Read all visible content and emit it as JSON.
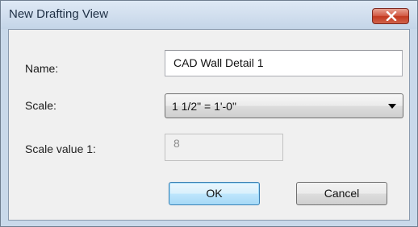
{
  "window": {
    "title": "New Drafting View"
  },
  "form": {
    "name_label": "Name:",
    "name_value": "CAD Wall Detail 1",
    "scale_label": "Scale:",
    "scale_selected": "1 1/2\" = 1'-0\"",
    "scale_value_label": "Scale value  1:",
    "scale_value": "8"
  },
  "buttons": {
    "ok": "OK",
    "cancel": "Cancel"
  },
  "icons": {
    "close": "close-icon",
    "dropdown": "chevron-down-icon"
  },
  "colors": {
    "titlebar": "#c4d5e8",
    "close_button": "#c2381f",
    "client_background": "#f0f0f0",
    "default_button_border": "#3c7fb1"
  }
}
